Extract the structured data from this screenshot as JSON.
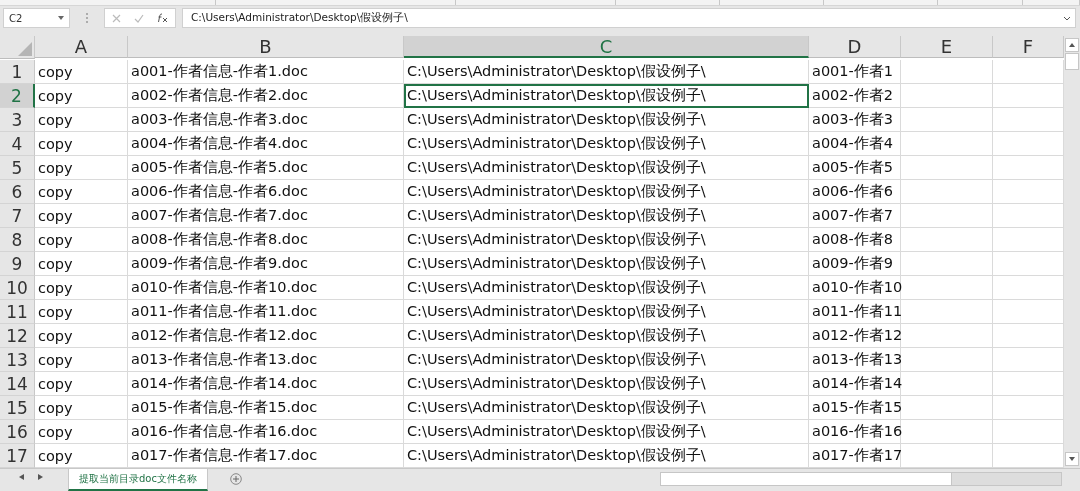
{
  "name_box": "C2",
  "formula": "C:\\Users\\Administrator\\Desktop\\假设例子\\",
  "columns": [
    {
      "label": "A",
      "selected": false
    },
    {
      "label": "B",
      "selected": false
    },
    {
      "label": "C",
      "selected": true
    },
    {
      "label": "D",
      "selected": false
    },
    {
      "label": "E",
      "selected": false
    },
    {
      "label": "F",
      "selected": false
    }
  ],
  "rows": [
    {
      "number": "1",
      "selected": false,
      "cells": [
        "copy",
        "a001-作者信息-作者1.doc",
        "C:\\Users\\Administrator\\Desktop\\假设例子\\",
        "a001-作者1"
      ]
    },
    {
      "number": "2",
      "selected": true,
      "cells": [
        "copy",
        "a002-作者信息-作者2.doc",
        "C:\\Users\\Administrator\\Desktop\\假设例子\\",
        "a002-作者2"
      ]
    },
    {
      "number": "3",
      "selected": false,
      "cells": [
        "copy",
        "a003-作者信息-作者3.doc",
        "C:\\Users\\Administrator\\Desktop\\假设例子\\",
        "a003-作者3"
      ]
    },
    {
      "number": "4",
      "selected": false,
      "cells": [
        "copy",
        "a004-作者信息-作者4.doc",
        "C:\\Users\\Administrator\\Desktop\\假设例子\\",
        "a004-作者4"
      ]
    },
    {
      "number": "5",
      "selected": false,
      "cells": [
        "copy",
        "a005-作者信息-作者5.doc",
        "C:\\Users\\Administrator\\Desktop\\假设例子\\",
        "a005-作者5"
      ]
    },
    {
      "number": "6",
      "selected": false,
      "cells": [
        "copy",
        "a006-作者信息-作者6.doc",
        "C:\\Users\\Administrator\\Desktop\\假设例子\\",
        "a006-作者6"
      ]
    },
    {
      "number": "7",
      "selected": false,
      "cells": [
        "copy",
        "a007-作者信息-作者7.doc",
        "C:\\Users\\Administrator\\Desktop\\假设例子\\",
        "a007-作者7"
      ]
    },
    {
      "number": "8",
      "selected": false,
      "cells": [
        "copy",
        "a008-作者信息-作者8.doc",
        "C:\\Users\\Administrator\\Desktop\\假设例子\\",
        "a008-作者8"
      ]
    },
    {
      "number": "9",
      "selected": false,
      "cells": [
        "copy",
        "a009-作者信息-作者9.doc",
        "C:\\Users\\Administrator\\Desktop\\假设例子\\",
        "a009-作者9"
      ]
    },
    {
      "number": "10",
      "selected": false,
      "cells": [
        "copy",
        "a010-作者信息-作者10.doc",
        "C:\\Users\\Administrator\\Desktop\\假设例子\\",
        "a010-作者10"
      ]
    },
    {
      "number": "11",
      "selected": false,
      "cells": [
        "copy",
        "a011-作者信息-作者11.doc",
        "C:\\Users\\Administrator\\Desktop\\假设例子\\",
        "a011-作者11"
      ]
    },
    {
      "number": "12",
      "selected": false,
      "cells": [
        "copy",
        "a012-作者信息-作者12.doc",
        "C:\\Users\\Administrator\\Desktop\\假设例子\\",
        "a012-作者12"
      ]
    },
    {
      "number": "13",
      "selected": false,
      "cells": [
        "copy",
        "a013-作者信息-作者13.doc",
        "C:\\Users\\Administrator\\Desktop\\假设例子\\",
        "a013-作者13"
      ]
    },
    {
      "number": "14",
      "selected": false,
      "cells": [
        "copy",
        "a014-作者信息-作者14.doc",
        "C:\\Users\\Administrator\\Desktop\\假设例子\\",
        "a014-作者14"
      ]
    },
    {
      "number": "15",
      "selected": false,
      "cells": [
        "copy",
        "a015-作者信息-作者15.doc",
        "C:\\Users\\Administrator\\Desktop\\假设例子\\",
        "a015-作者15"
      ]
    },
    {
      "number": "16",
      "selected": false,
      "cells": [
        "copy",
        "a016-作者信息-作者16.doc",
        "C:\\Users\\Administrator\\Desktop\\假设例子\\",
        "a016-作者16"
      ]
    },
    {
      "number": "17",
      "selected": false,
      "cells": [
        "copy",
        "a017-作者信息-作者17.doc",
        "C:\\Users\\Administrator\\Desktop\\假设例子\\",
        "a017-作者17"
      ]
    }
  ],
  "sheet_tabs": [
    {
      "label": "提取当前目录doc文件名称",
      "selected": true
    }
  ]
}
